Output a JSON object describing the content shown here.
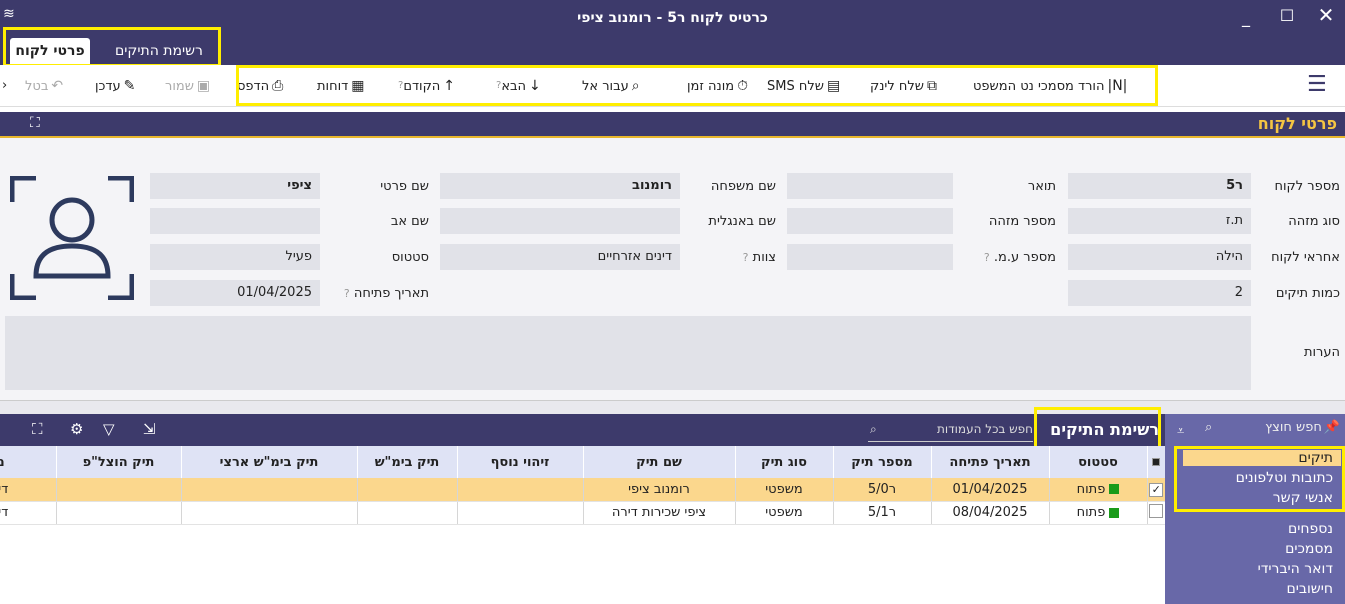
{
  "window": {
    "title": "כרטיס לקוח ר5 - רומנוב ציפי",
    "close": "✕",
    "maximize": "☐",
    "minimize": "_"
  },
  "tabs": [
    {
      "label": "פרטי לקוח"
    },
    {
      "label": "רשימת התיקים"
    }
  ],
  "toolbar": {
    "download": "הורד מסמכי נט המשפט",
    "send_link": "שלח לינק",
    "send_sms": "שלח SMS",
    "timer": "מונה זמן",
    "goto": "עבור אל",
    "next": "הבא",
    "prev": "הקודם",
    "reports": "דוחות",
    "print": "הדפס",
    "save": "שמור",
    "update": "עדכן",
    "cancel": "בטל"
  },
  "section": {
    "title": "פרטי לקוח"
  },
  "form": {
    "client_number": {
      "label": "מספר לקוח",
      "value": "ר5"
    },
    "id_type": {
      "label": "סוג מזהה",
      "value": "ת.ז"
    },
    "responsible": {
      "label": "אחראי לקוח",
      "value": "הילה"
    },
    "files_count": {
      "label": "כמות תיקים",
      "value": "2"
    },
    "title": {
      "label": "תואר",
      "value": ""
    },
    "id_number": {
      "label": "מספר מזהה",
      "value": ""
    },
    "vat_number": {
      "label": "מספר ע.מ.",
      "value": ""
    },
    "last_name": {
      "label": "שם משפחה",
      "value": "רומנוב"
    },
    "english_name": {
      "label": "שם באנגלית",
      "value": ""
    },
    "team": {
      "label": "צוות",
      "value": "דינים אזרחיים"
    },
    "first_name": {
      "label": "שם פרטי",
      "value": "ציפי"
    },
    "father_name": {
      "label": "שם אב",
      "value": ""
    },
    "status": {
      "label": "סטטוס",
      "value": "פעיל"
    },
    "open_date": {
      "label": "תאריך פתיחה",
      "value": "01/04/2025"
    },
    "notes": {
      "label": "הערות",
      "value": ""
    }
  },
  "files": {
    "title": "רשימת התיקים",
    "search_placeholder": "חפש בכל העמודות",
    "columns": [
      "סטטוס",
      "תאריך פתיחה",
      "מספר תיק",
      "סוג תיק",
      "שם תיק",
      "זיהוי נוסף",
      "תיק בימ\"ש",
      "תיק בימ\"ש ארצי",
      "תיק הוצל\"פ",
      "מס"
    ],
    "rows": [
      {
        "checked": "✓",
        "status": "פתוח",
        "open_date": "01/04/2025",
        "file_number": "ר5/0",
        "file_type": "משפטי",
        "file_name": "רומנוב ציפי",
        "extra_id": "",
        "court_file": "",
        "national_court_file": "",
        "execution_file": "",
        "tax": "דיווח"
      },
      {
        "checked": "",
        "status": "פתוח",
        "open_date": "08/04/2025",
        "file_number": "ר5/1",
        "file_type": "משפטי",
        "file_name": "ציפי שכירות דירה",
        "extra_id": "",
        "court_file": "",
        "national_court_file": "",
        "execution_file": "",
        "tax": "דיווח"
      }
    ]
  },
  "sidepanel": {
    "search_placeholder": "חפש חוצץ",
    "items": [
      "תיקים",
      "כתובות וטלפונים",
      "אנשי קשר",
      "נספחים",
      "מסמכים",
      "דואר היברידי",
      "חישובים"
    ]
  },
  "colors": {
    "header_bg": "#3d3a6b",
    "accent": "#f5c542",
    "selected_row": "#fbd78d",
    "side_panel": "#6868a8",
    "status_open": "#1a9b1a"
  }
}
